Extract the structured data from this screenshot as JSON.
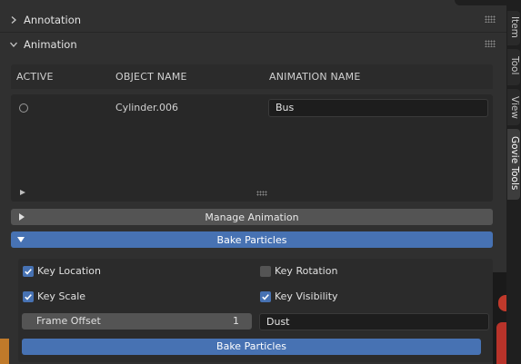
{
  "panels": {
    "annotation": {
      "label": "Annotation",
      "expanded": false
    },
    "animation": {
      "label": "Animation",
      "expanded": true
    }
  },
  "animation_list": {
    "columns": [
      "ACTIVE",
      "OBJECT NAME",
      "ANIMATION NAME"
    ],
    "rows": [
      {
        "active": false,
        "object_name": "Cylinder.006",
        "animation_name": "Bus"
      }
    ]
  },
  "manage_animation": {
    "label": "Manage Animation",
    "expanded": false
  },
  "bake_particles": {
    "header_label": "Bake Particles",
    "expanded": true,
    "key_location": {
      "label": "Key Location",
      "checked": true
    },
    "key_rotation": {
      "label": "Key Rotation",
      "checked": false
    },
    "key_scale": {
      "label": "Key Scale",
      "checked": true
    },
    "key_visibility": {
      "label": "Key Visibility",
      "checked": true
    },
    "frame_offset": {
      "label": "Frame Offset",
      "value": "1"
    },
    "collection_name": "Dust",
    "button_label": "Bake Particles"
  },
  "sidebar_tabs": [
    {
      "label": "Item",
      "active": false
    },
    {
      "label": "Tool",
      "active": false
    },
    {
      "label": "View",
      "active": false
    },
    {
      "label": "Govie Tools",
      "active": true
    }
  ],
  "colors": {
    "accent": "#4772b3",
    "panel_bg": "#303030",
    "button_bg": "#545454",
    "field_bg": "#1d1d1d"
  }
}
